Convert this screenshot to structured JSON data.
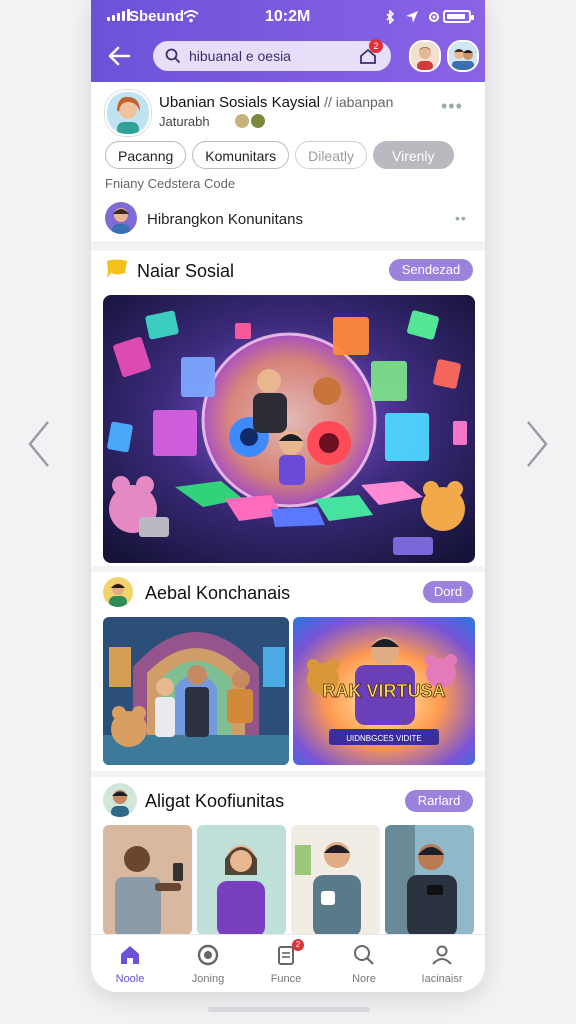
{
  "status_bar": {
    "carrier": "Sbeund",
    "time": "10:2M"
  },
  "header": {
    "search": {
      "value": "hibuanal e oesia"
    },
    "notification_count": "2"
  },
  "group": {
    "title": "Ubanian Sosials Kaysial",
    "title_suffix": "// iabanpan",
    "subtitle": "Jaturabh"
  },
  "chips": [
    "Pacanng",
    "Komunitars",
    "Dileatly",
    "Virenly"
  ],
  "helper_text": "Fniany Cedstera Code",
  "community_row": {
    "label": "Hibrangkon Konunitans"
  },
  "sections": {
    "first": {
      "title": "Naiar Sosial",
      "action": "Sendezad"
    },
    "second": {
      "title": "Aebal Konchanais",
      "action": "Dord"
    },
    "third": {
      "title": "Aligat Koofiunitas",
      "action": "Rarlard"
    }
  },
  "poster": {
    "title": "RAK VIRTUSA",
    "subtitle": "UIDNBGCES VIDITE"
  },
  "bottom_nav": {
    "items": [
      {
        "label": "Noole",
        "icon": "home-icon"
      },
      {
        "label": "Joning",
        "icon": "explore-icon"
      },
      {
        "label": "Funce",
        "icon": "document-icon"
      },
      {
        "label": "Nore",
        "icon": "search-icon"
      },
      {
        "label": "Iacinaisr",
        "icon": "profile-icon"
      }
    ],
    "badge": "2"
  },
  "colors": {
    "accent": "#6c52d8",
    "pill": "#9b82dc",
    "badge": "#e0303a"
  }
}
